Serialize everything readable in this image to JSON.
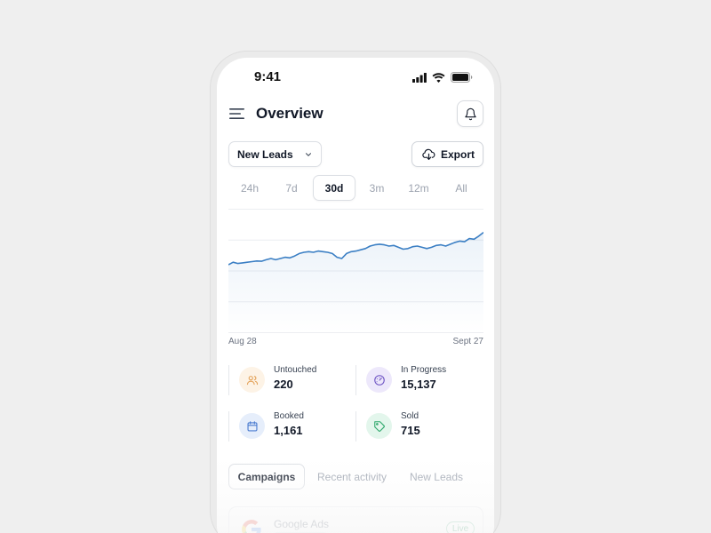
{
  "status_bar": {
    "time": "9:41"
  },
  "header": {
    "title": "Overview"
  },
  "controls": {
    "dropdown_label": "New Leads",
    "export_label": "Export"
  },
  "range_tabs": [
    {
      "label": "24h"
    },
    {
      "label": "7d"
    },
    {
      "label": "30d",
      "active": true
    },
    {
      "label": "3m"
    },
    {
      "label": "12m"
    },
    {
      "label": "All"
    }
  ],
  "chart_data": {
    "type": "area",
    "x_labels": [
      "Aug 28",
      "Sept 27"
    ],
    "values": [
      55,
      57,
      56,
      56.5,
      57,
      57.5,
      58,
      57.8,
      59,
      60,
      59,
      60,
      61,
      60.5,
      62,
      64,
      65,
      65.5,
      65,
      66,
      65.5,
      65,
      64,
      61,
      60,
      64,
      65.5,
      66,
      67,
      68,
      70,
      71,
      71.5,
      71,
      70,
      70.5,
      69,
      67.5,
      68,
      69.5,
      70,
      69,
      68,
      69,
      70.5,
      71,
      70,
      71.5,
      73,
      74,
      73.5,
      76,
      75.5,
      78,
      81
    ],
    "ylim": [
      0,
      100
    ],
    "grid": true,
    "color": "#3b7fc4"
  },
  "stats": [
    {
      "label": "Untouched",
      "value": "220",
      "icon": "users-icon",
      "color": "#e4a35a",
      "bg": "#fdf3e6"
    },
    {
      "label": "In Progress",
      "value": "15,137",
      "icon": "gauge-icon",
      "color": "#6f55c4",
      "bg": "#ede8fb"
    },
    {
      "label": "Booked",
      "value": "1,161",
      "icon": "calendar-icon",
      "color": "#4a7bd0",
      "bg": "#e6eefb"
    },
    {
      "label": "Sold",
      "value": "715",
      "icon": "tag-icon",
      "color": "#2fa86c",
      "bg": "#e3f6ec"
    }
  ],
  "bottom_tabs": [
    {
      "label": "Campaigns",
      "active": true
    },
    {
      "label": "Recent activity"
    },
    {
      "label": "New Leads"
    }
  ],
  "campaign": {
    "name": "Google Ads",
    "status": "Live"
  }
}
